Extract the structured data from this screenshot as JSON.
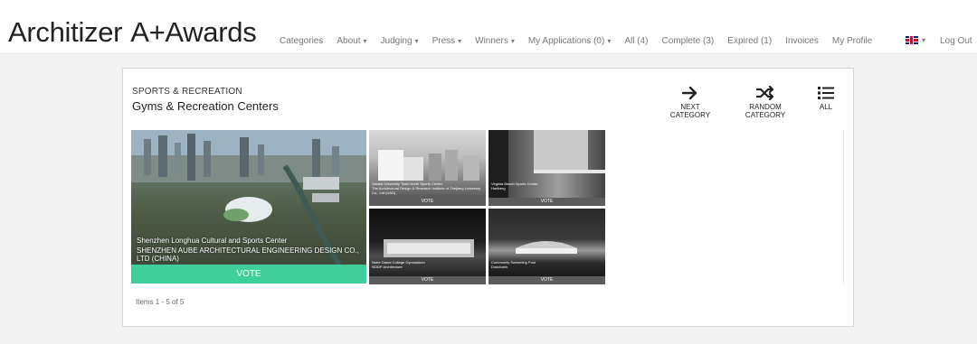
{
  "header": {
    "logo": "Architizer A+Awards",
    "logo_left": "Architizer",
    "logo_right": "A+Awards",
    "nav": [
      {
        "label": "Categories",
        "caret": false
      },
      {
        "label": "About",
        "caret": true
      },
      {
        "label": "Judging",
        "caret": true
      },
      {
        "label": "Press",
        "caret": true
      },
      {
        "label": "Winners",
        "caret": true
      },
      {
        "label": "My Applications (0)",
        "caret": true
      },
      {
        "label": "All (4)",
        "caret": false
      },
      {
        "label": "Complete (3)",
        "caret": false
      },
      {
        "label": "Expired (1)",
        "caret": false
      },
      {
        "label": "Invoices",
        "caret": false
      },
      {
        "label": "My Profile",
        "caret": false
      }
    ],
    "caret_glyph": "▾",
    "language_icon": "uk-flag-icon",
    "logout": "Log Out"
  },
  "category": {
    "group": "SPORTS & RECREATION",
    "title": "Gyms & Recreation Centers"
  },
  "controls": {
    "next": "NEXT CATEGORY",
    "random": "RANDOM CATEGORY",
    "all": "ALL"
  },
  "entries": {
    "featured": {
      "title": "Shenzhen Longhua Cultural and Sports Center",
      "firm": "SHENZHEN AUBE ARCHITECTURAL ENGINEERING DESIGN CO., LTD (CHINA)",
      "vote": "VOTE"
    },
    "tile1": {
      "title": "Xiaotai University Town North Sports Center",
      "firm": "The Architectural Design & Research Institute of Zhejiang University Co., Ltd (UAD)",
      "vote": "VOTE"
    },
    "tile2": {
      "title": "Virginia Beach Sports Center",
      "firm": "Hartberg",
      "vote": "VOTE"
    },
    "tile3": {
      "title": "Notre Dame College Gymnasium",
      "firm": "NODP Architecture",
      "vote": "VOTE"
    },
    "tile4": {
      "title": "Community Swimming Pool",
      "firm": "Dukubarin",
      "vote": "VOTE"
    }
  },
  "pagination": "Items 1 - 5 of 5",
  "colors": {
    "vote_primary": "#3ecf9a",
    "vote_secondary": "#5c5c5c",
    "page_bg": "#f2f2f2"
  }
}
